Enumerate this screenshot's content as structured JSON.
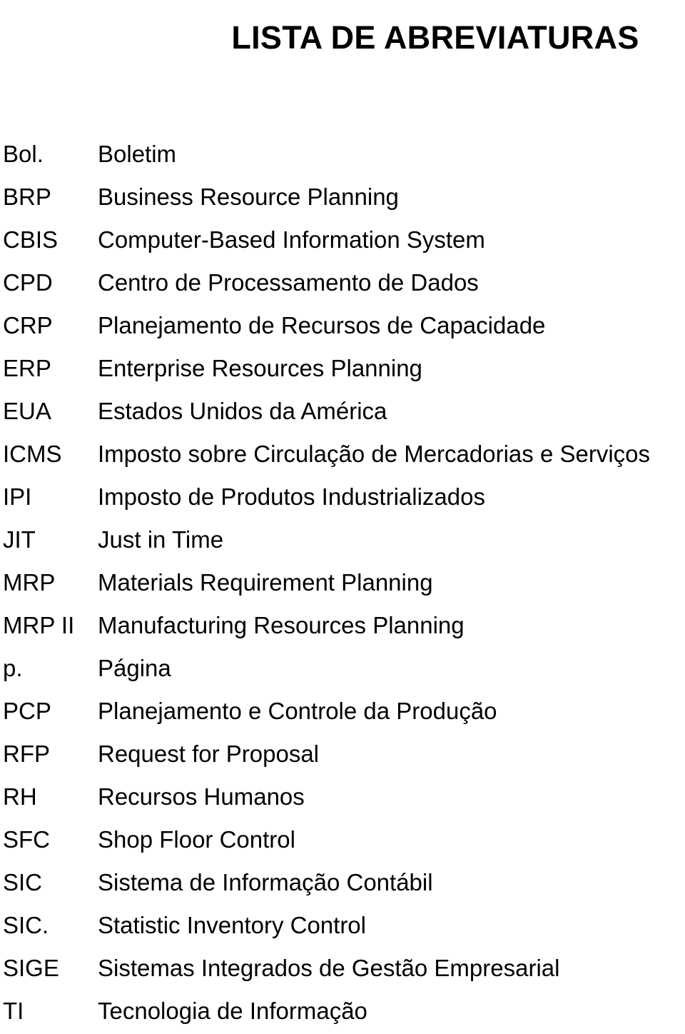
{
  "document": {
    "title": "LISTA DE ABREVIATURAS",
    "page_background": "#ffffff",
    "text_color": "#000000"
  },
  "abbreviations": [
    {
      "term": "Bol.",
      "definition": "Boletim"
    },
    {
      "term": "BRP",
      "definition": "Business Resource Planning"
    },
    {
      "term": "CBIS",
      "definition": "Computer-Based Information System"
    },
    {
      "term": "CPD",
      "definition": "Centro de Processamento de Dados"
    },
    {
      "term": "CRP",
      "definition": "Planejamento de Recursos de Capacidade"
    },
    {
      "term": "ERP",
      "definition": "Enterprise Resources Planning"
    },
    {
      "term": "EUA",
      "definition": "Estados Unidos da América"
    },
    {
      "term": "ICMS",
      "definition": "Imposto sobre Circulação de Mercadorias e Serviços"
    },
    {
      "term": "IPI",
      "definition": "Imposto de Produtos Industrializados"
    },
    {
      "term": "JIT",
      "definition": "Just in Time"
    },
    {
      "term": "MRP",
      "definition": "Materials Requirement Planning"
    },
    {
      "term": "MRP II",
      "definition": "Manufacturing Resources Planning"
    },
    {
      "term": "p.",
      "definition": "Página"
    },
    {
      "term": "PCP",
      "definition": "Planejamento e Controle da Produção"
    },
    {
      "term": "RFP",
      "definition": "Request for Proposal"
    },
    {
      "term": "RH",
      "definition": "Recursos Humanos"
    },
    {
      "term": "SFC",
      "definition": "Shop Floor Control"
    },
    {
      "term": "SIC",
      "definition": "Sistema de Informação Contábil"
    },
    {
      "term": "SIC.",
      "definition": "Statistic Inventory Control"
    },
    {
      "term": "SIGE",
      "definition": "Sistemas Integrados de Gestão Empresarial"
    },
    {
      "term": "TI",
      "definition": "Tecnologia de Informação"
    }
  ]
}
